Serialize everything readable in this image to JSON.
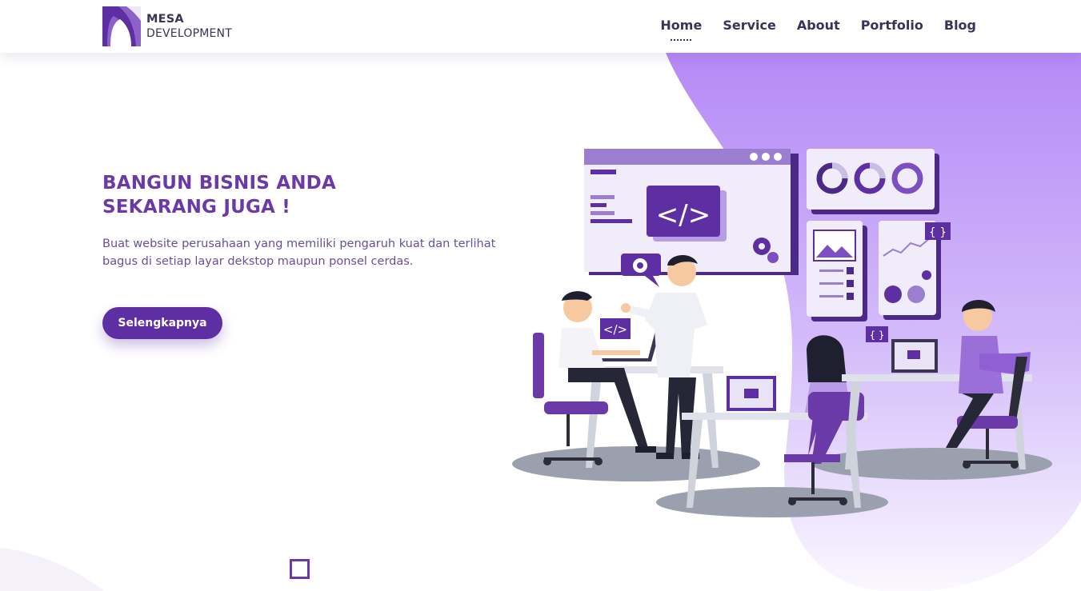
{
  "brand": {
    "name": "MESA",
    "subtitle": "DEVELOPMENT",
    "logo_icon": "arch-logo-icon"
  },
  "nav": {
    "items": [
      {
        "label": "Home",
        "active": true
      },
      {
        "label": "Service",
        "active": false
      },
      {
        "label": "About",
        "active": false
      },
      {
        "label": "Portfolio",
        "active": false
      },
      {
        "label": "Blog",
        "active": false
      }
    ]
  },
  "hero": {
    "title_line1": "BANGUN BISNIS ANDA",
    "title_line2": "SEKARANG JUGA !",
    "text_line1": "Buat website perusahaan yang memiliki pengaruh kuat dan terlihat",
    "text_line2": "bagus di setiap layar dekstop maupun ponsel cerdas.",
    "cta_label": "Selengkapnya"
  },
  "illustration": {
    "code_symbol": "</>",
    "brace_symbol": "{ }",
    "icon": "team-working-illustration"
  },
  "colors": {
    "primary": "#5e2fa3",
    "heading": "#6a3aa8",
    "blob": "#b892f3",
    "text": "#3b3355"
  }
}
